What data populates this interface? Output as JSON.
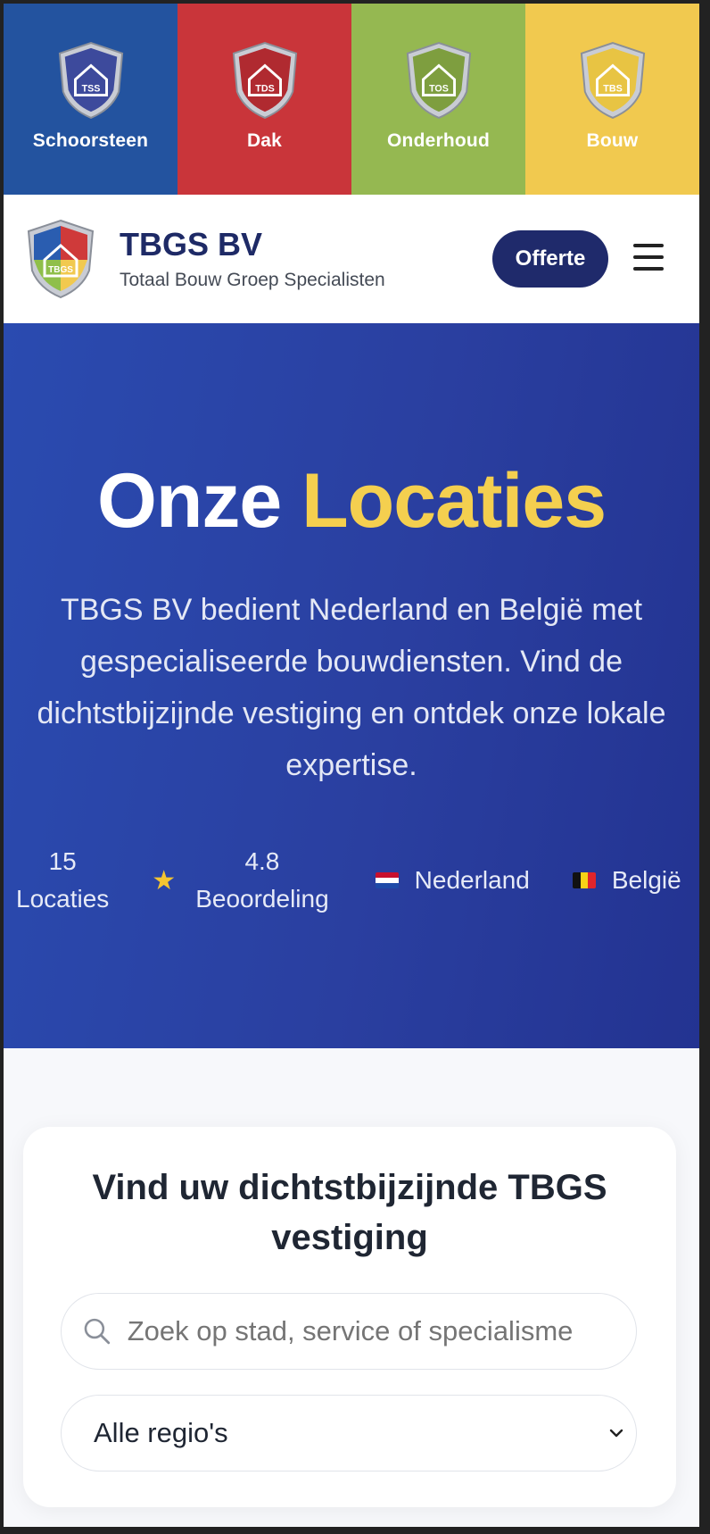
{
  "categories": [
    {
      "label": "Schoorsteen",
      "color": "#23539f"
    },
    {
      "label": "Dak",
      "color": "#c9353a"
    },
    {
      "label": "Onderhoud",
      "color": "#95b851"
    },
    {
      "label": "Bouw",
      "color": "#f1c94f"
    }
  ],
  "header": {
    "title": "TBGS BV",
    "subtitle": "Totaal Bouw Groep Specialisten",
    "cta_label": "Offerte"
  },
  "hero": {
    "title_main": "Onze",
    "title_accent": "Locaties",
    "description": "TBGS BV bedient Nederland en België met gespecialiseerde bouwdiensten. Vind de dichtstbijzijnde vestiging en ontdek onze lokale expertise.",
    "stats": {
      "locations_value": "15",
      "locations_label": "Locaties",
      "rating_value": "4.8",
      "rating_label": "Beoordeling",
      "country_nl": "Nederland",
      "country_be": "België"
    }
  },
  "search": {
    "heading": "Vind uw dichtstbijzijnde TBGS vestiging",
    "placeholder": "Zoek op stad, service of specialisme",
    "region_selected": "Alle regio's"
  },
  "colors": {
    "brand_navy": "#1f2a6b",
    "accent_yellow": "#f4cf4f",
    "hero_blue": "#2a4bb0"
  }
}
